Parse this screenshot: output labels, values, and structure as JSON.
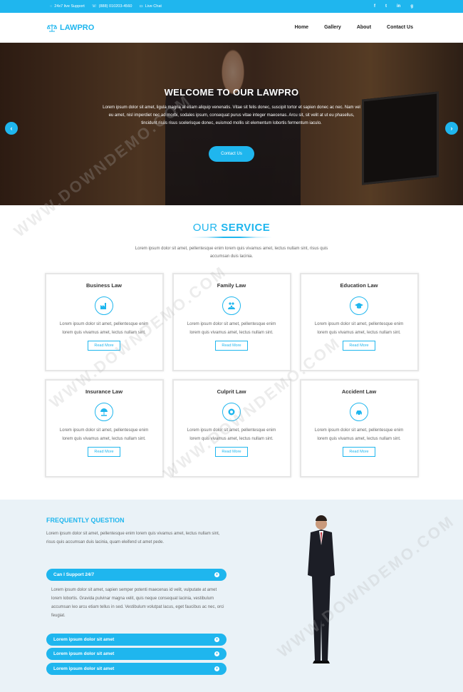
{
  "topbar": {
    "support": "24x7 live Support",
    "phone": "(888) 010203-4560",
    "chat": "Live Chat",
    "social": [
      "f",
      "t",
      "in",
      "g"
    ]
  },
  "brand": {
    "name": "LAWPRO"
  },
  "menu": [
    "Home",
    "Gallery",
    "About",
    "Contact Us"
  ],
  "hero": {
    "title": "WELCOME TO OUR LAWPRO",
    "text": "Lorem ipsum dolor sit amet, ligula magna at etiam aliquip venenatis. Vitae sit felis donec, suscipit tortor et sapien donec ac nec. Nam vel eu amet, nisl imperdiet nec ad morbi, sodales ipsum, consequat purus vitae integer maecenas. Arcu sit, sit velit at ut eu phasellus, tincidunt risus risus scelerisque donec, euismod mollis sit elementum lobortis fermentum iaculo.",
    "button": "Contact Us"
  },
  "service": {
    "title_light": "OUR",
    "title_bold": "SERVICE",
    "intro": "Lorem ipsum dolor sit amet, pellentesque enim lorem quis vivamus amet, lectus nullam sint, risus quis accumsan duis lacinia.",
    "cards": [
      {
        "title": "Business Law",
        "icon": "factory-icon",
        "text": "Lorem ipsum dolor sit amet, pellentesque enim lorem quis vivamus amet, lectus nullam sint.",
        "button": "Read More"
      },
      {
        "title": "Family Law",
        "icon": "family-icon",
        "text": "Lorem ipsum dolor sit amet, pellentesque enim lorem quis vivamus amet, lectus nullam sint.",
        "button": "Read More"
      },
      {
        "title": "Education Law",
        "icon": "graduation-cap-icon",
        "text": "Lorem ipsum dolor sit amet, pellentesque enim lorem quis vivamus amet, lectus nullam sint.",
        "button": "Read More"
      },
      {
        "title": "Insurance Law",
        "icon": "umbrella-hand-icon",
        "text": "Lorem ipsum dolor sit amet, pellentesque enim lorem quis vivamus amet, lectus nullam sint.",
        "button": "Read More"
      },
      {
        "title": "Culprit Law",
        "icon": "handcuffs-icon",
        "text": "Lorem ipsum dolor sit amet, pellentesque enim lorem quis vivamus amet, lectus nullam sint.",
        "button": "Read More"
      },
      {
        "title": "Accident Law",
        "icon": "car-icon",
        "text": "Lorem ipsum dolor sit amet, pellentesque enim lorem quis vivamus amet, lectus nullam sint.",
        "button": "Read More"
      }
    ]
  },
  "faq": {
    "title": "FREQUENTLY QUESTION",
    "intro": "Lorem ipsum dolor sit amet, pellentesque enim lorem quis vivamus amet, lectus nullam sint, risus quis accumsan duis lacinia, quam eleifend ut amet pede.",
    "open_question": "Can I Support 24/7",
    "answer": "Lorem ipsum dolor sit amet, sapien semper potenti maecenas id velit, vulputate at amet lorem lobortis. Gravida pulvinar magna velit, quis neque consequat lacinia, vestibulum accumsan leo arcu etiam tellus in sed. Vestibulum volutpat lacus, eget faucibus ac nec, orci feugiat.",
    "questions": [
      "Lorem ipsum dolor sit amet",
      "Lorem ipsum dolor sit amet",
      "Lorem ipsum dolor sit amet"
    ]
  },
  "watermark": "WWW.DOWNDEMO.COM",
  "colors": {
    "accent": "#1fb6ee",
    "faq_bg": "#eaf2f7"
  }
}
